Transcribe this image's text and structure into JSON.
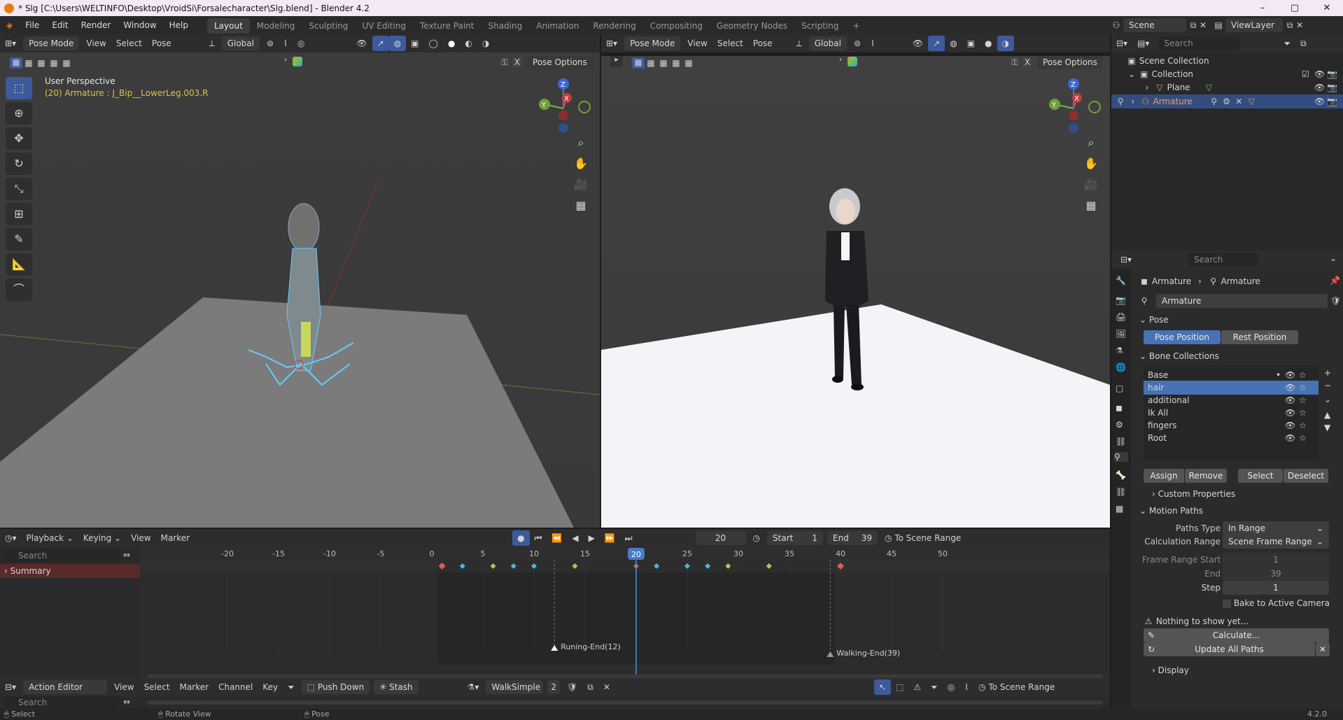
{
  "window": {
    "title": "* Slg [C:\\Users\\WELTINFO\\Desktop\\VroidSi\\Forsalecharacter\\Slg.blend] - Blender 4.2",
    "controls": [
      "–",
      "▢",
      "✕"
    ]
  },
  "menubar": {
    "items": [
      "File",
      "Edit",
      "Render",
      "Window",
      "Help"
    ],
    "workspaces": [
      "Layout",
      "Modeling",
      "Sculpting",
      "UV Editing",
      "Texture Paint",
      "Shading",
      "Animation",
      "Rendering",
      "Compositing",
      "Geometry Nodes",
      "Scripting"
    ],
    "active_workspace": "Layout",
    "add_tab": "+",
    "scene_label": "Scene",
    "viewlayer_label": "ViewLayer"
  },
  "viewport_left": {
    "mode": "Pose Mode",
    "menus": [
      "View",
      "Select",
      "Pose"
    ],
    "transform": "Global",
    "pose_options": "Pose Options",
    "info_title": "User Perspective",
    "info_sub": "(20) Armature : J_Bip__LowerLeg.003.R",
    "gizmo": {
      "x": "X",
      "y": "Y",
      "z": "Z"
    }
  },
  "viewport_right": {
    "mode": "Pose Mode",
    "menus": [
      "View",
      "Select",
      "Pose"
    ],
    "transform": "Global",
    "pose_options": "Pose Options",
    "gizmo": {
      "x": "X",
      "y": "Y",
      "z": "Z"
    }
  },
  "outliner": {
    "search_placeholder": "Search",
    "items": [
      {
        "label": "Scene Collection",
        "level": 0
      },
      {
        "label": "Collection",
        "level": 1
      },
      {
        "label": "Plane",
        "level": 2
      },
      {
        "label": "Armature",
        "level": 2,
        "selected": true
      }
    ]
  },
  "properties": {
    "search_placeholder": "Search",
    "breadcrumb": [
      "Armature",
      "Armature"
    ],
    "datablock": "Armature",
    "pose_section": "Pose",
    "pose_position": "Pose Position",
    "rest_position": "Rest Position",
    "bone_collections_section": "Bone Collections",
    "bone_collections": [
      "Base",
      "hair",
      "additional",
      "Ik All",
      "fingers",
      "Root"
    ],
    "active_bone_collection": "hair",
    "bc_buttons": [
      "Assign",
      "Remove",
      "Select",
      "Deselect"
    ],
    "custom_properties": "Custom Properties",
    "motion_paths_section": "Motion Paths",
    "paths_type_label": "Paths Type",
    "paths_type_value": "In Range",
    "calc_range_label": "Calculation Range",
    "calc_range_value": "Scene Frame Range",
    "frame_range_start_label": "Frame Range Start",
    "frame_range_start_value": "1",
    "end_label": "End",
    "end_value": "39",
    "step_label": "Step",
    "step_value": "1",
    "bake_label": "Bake to Active Camera",
    "nothing_label": "Nothing to show yet...",
    "calculate_label": "Calculate...",
    "update_label": "Update All Paths",
    "display_label": "Display",
    "version": "4.2.0"
  },
  "timeline": {
    "menus": [
      "Playback",
      "Keying",
      "View",
      "Marker"
    ],
    "current_frame": "20",
    "start_label": "Start",
    "start_value": "1",
    "end_label": "End",
    "end_value": "39",
    "to_scene_range": "To Scene Range",
    "search_placeholder": "Search",
    "summary_label": "Summary",
    "ruler": [
      "-20",
      "-15",
      "-10",
      "-5",
      "0",
      "5",
      "10",
      "15",
      "20",
      "25",
      "30",
      "35",
      "40",
      "45",
      "50"
    ],
    "markers": [
      {
        "label": "Runing-End(12)",
        "frame": 12
      },
      {
        "label": "Walking-End(39)",
        "frame": 39
      }
    ],
    "keyframes": [
      1,
      3,
      6,
      8,
      10,
      14,
      20,
      22,
      25,
      27,
      29,
      33,
      40
    ],
    "playhead_frame": 20
  },
  "action_editor": {
    "mode": "Action Editor",
    "menus": [
      "View",
      "Select",
      "Marker",
      "Channel",
      "Key"
    ],
    "push_down": "Push Down",
    "stash": "Stash",
    "action_name": "WalkSimple",
    "users": "2",
    "to_scene_range": "To Scene Range",
    "search_placeholder": "Search"
  },
  "statusbar": {
    "items": [
      "Select",
      "Rotate View",
      "Pose"
    ]
  }
}
